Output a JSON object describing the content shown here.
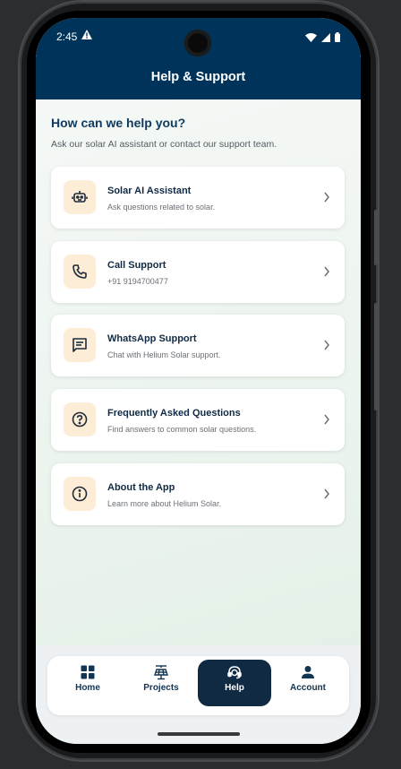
{
  "status": {
    "time": "2:45"
  },
  "header": {
    "title": "Help & Support"
  },
  "intro": {
    "title": "How can we help you?",
    "subtitle": "Ask our solar AI assistant or contact our support team."
  },
  "cards": [
    {
      "title": "Solar AI Assistant",
      "subtitle": "Ask questions related to solar.",
      "icon": "robot-icon"
    },
    {
      "title": "Call Support",
      "subtitle": "+91 9194700477",
      "icon": "phone-icon"
    },
    {
      "title": "WhatsApp Support",
      "subtitle": "Chat with Helium Solar support.",
      "icon": "chat-icon"
    },
    {
      "title": "Frequently Asked Questions",
      "subtitle": "Find answers to common solar questions.",
      "icon": "question-icon"
    },
    {
      "title": "About the App",
      "subtitle": "Learn more about Helium Solar.",
      "icon": "info-icon"
    }
  ],
  "nav": [
    {
      "label": "Home",
      "icon": "grid-icon"
    },
    {
      "label": "Projects",
      "icon": "solar-panel-icon"
    },
    {
      "label": "Help",
      "icon": "support-agent-icon",
      "active": true
    },
    {
      "label": "Account",
      "icon": "person-icon"
    }
  ],
  "colors": {
    "header": "#003359",
    "accent": "#112a44",
    "icon_bg": "#fdecd6"
  }
}
